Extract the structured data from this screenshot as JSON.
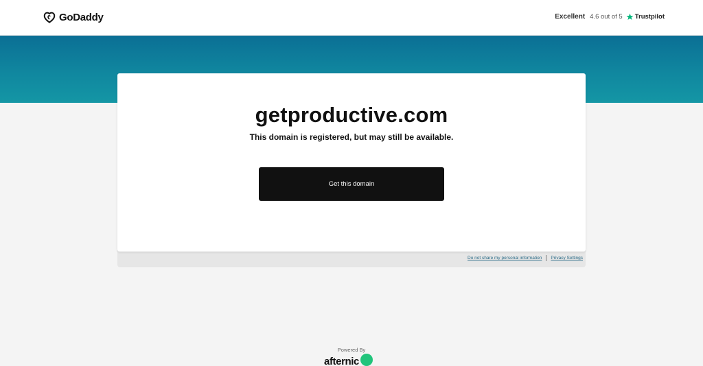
{
  "header": {
    "brand": "GoDaddy",
    "rating_word": "Excellent",
    "rating_score": "4.6 out of 5",
    "trustpilot": "Trustpilot"
  },
  "card": {
    "domain": "getproductive.com",
    "subtitle": "This domain is registered, but may still be available.",
    "cta_label": "Get this domain"
  },
  "footer_links": {
    "privacy_optout": "Do not share my personal information",
    "privacy_settings": "Privacy Settings"
  },
  "powered_by": {
    "label": "Powered By",
    "brand": "afternic"
  },
  "colors": {
    "banner_top": "#0b6f95",
    "banner_bottom": "#1496a5",
    "cta_bg": "#111111",
    "trustpilot_star": "#00b67a",
    "afternic_mark": "#21c47b"
  },
  "icons": {
    "logo": "godaddy-logo-icon",
    "star": "trustpilot-star-icon",
    "afternic": "afternic-mark-icon"
  }
}
